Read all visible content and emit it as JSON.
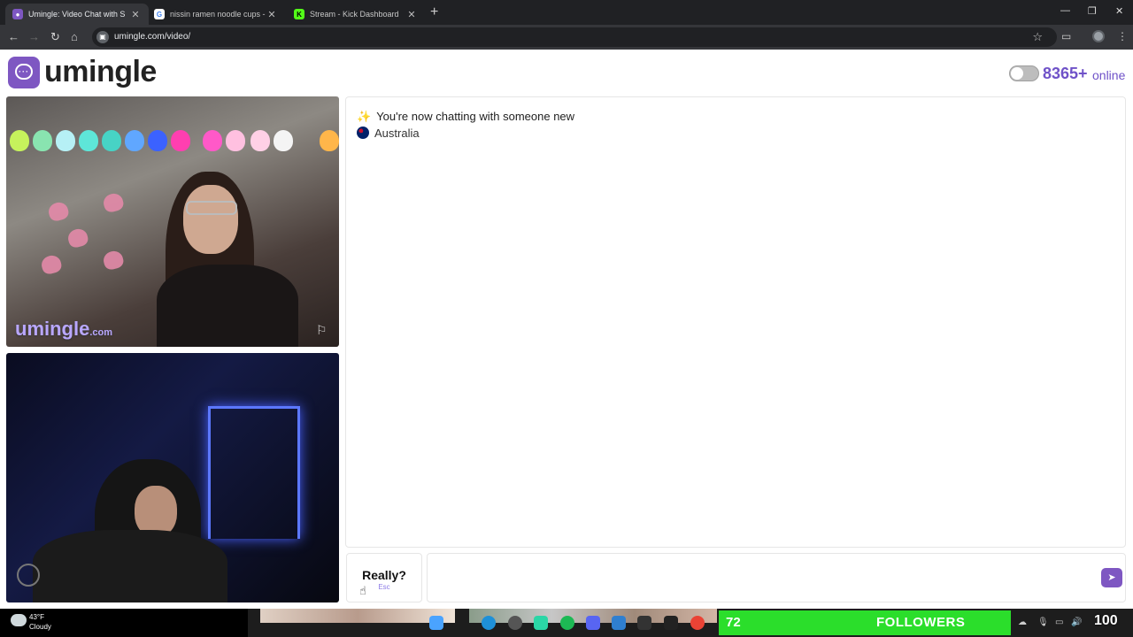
{
  "browser": {
    "tabs": [
      {
        "title": "Umingle: Video Chat with S",
        "active": true
      },
      {
        "title": "nissin ramen noodle cups - Goo",
        "active": false
      },
      {
        "title": "Stream - Kick Dashboard",
        "active": false
      }
    ],
    "url": "umingle.com/video/",
    "new_tab": "+"
  },
  "header": {
    "logo_text": "umingle",
    "online_count": "8365+",
    "online_label": "online",
    "toggle_on": false
  },
  "videos": {
    "stranger_watermark": "umingle",
    "stranger_watermark_suffix": ".com"
  },
  "chat": {
    "system_message": "You're now chatting with someone new",
    "country": "Australia",
    "escape_button": {
      "label": "Really?",
      "key_hint": "Esc"
    },
    "input_value": "",
    "send_icon": "send-arrow-icon"
  },
  "taskbar": {
    "temperature": "43°F",
    "condition": "Cloudy",
    "followers_count": "72",
    "followers_label": "FOLLOWERS",
    "overlay_number": "100"
  },
  "colors": {
    "brand": "#7e57c2",
    "online_text": "#6f52c8",
    "followers_bg": "#2bde2b"
  }
}
